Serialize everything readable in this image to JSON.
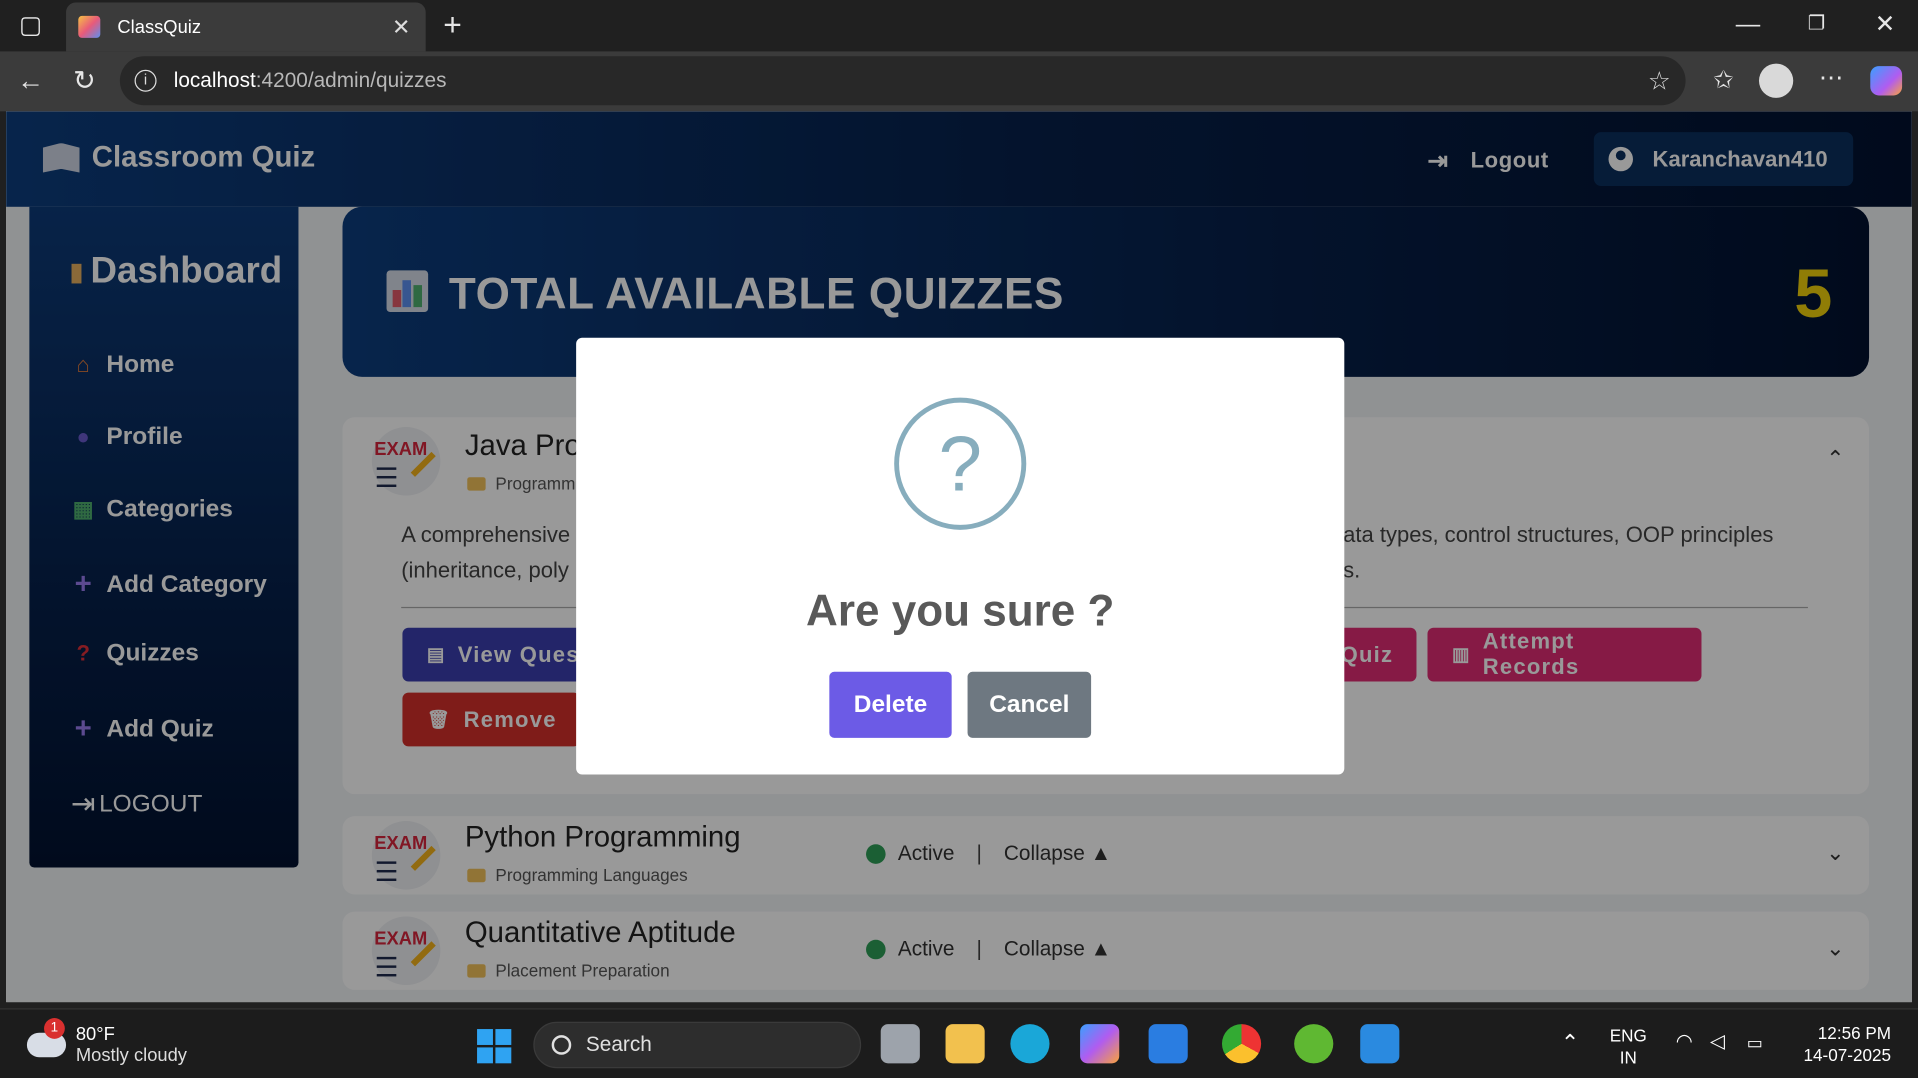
{
  "browser": {
    "tab_title": "ClassQuiz",
    "url_host": "localhost",
    "url_path": ":4200/admin/quizzes"
  },
  "app": {
    "brand": "Classroom Quiz",
    "logout_label": "Logout",
    "username": "Karanchavan410"
  },
  "sidebar": {
    "title": "Dashboard",
    "items": [
      {
        "label": "Home",
        "icon": "home-icon"
      },
      {
        "label": "Profile",
        "icon": "profile-icon"
      },
      {
        "label": "Categories",
        "icon": "categories-icon"
      },
      {
        "label": "Add Category",
        "icon": "plus-icon"
      },
      {
        "label": "Quizzes",
        "icon": "question-icon"
      },
      {
        "label": "Add Quiz",
        "icon": "plus-icon"
      },
      {
        "label": "LOGOUT",
        "icon": "logout-icon"
      }
    ]
  },
  "hero": {
    "title": "TOTAL AVAILABLE QUIZZES",
    "count": "5"
  },
  "quizzes": [
    {
      "title": "Java Pro",
      "category": "Programm",
      "description_line1": "A comprehensive",
      "description_line1_end": "data types, control structures, OOP principles",
      "description_line2": "(inheritance, poly",
      "description_line2_end": "es.",
      "buttons": {
        "view": "View Ques",
        "update_partial": "Quiz",
        "attempts": "Attempt Records",
        "remove": "Remove"
      }
    },
    {
      "title": "Python Programming",
      "category": "Programming Languages",
      "status": "Active",
      "sep": "|",
      "toggle": "Collapse ▲"
    },
    {
      "title": "Quantitative Aptitude",
      "category": "Placement Preparation",
      "status": "Active",
      "sep": "|",
      "toggle": "Collapse ▲"
    }
  ],
  "modal": {
    "icon": "?",
    "message": "Are you sure ?",
    "confirm": "Delete",
    "cancel": "Cancel"
  },
  "taskbar": {
    "weather_badge": "1",
    "temp": "80°F",
    "condition": "Mostly cloudy",
    "search_placeholder": "Search",
    "lang1": "ENG",
    "lang2": "IN",
    "time": "12:56 PM",
    "date": "14-07-2025"
  },
  "colors": {
    "primary": "#6c5be6",
    "cancel": "#6e7881",
    "view": "#3b3fb0",
    "pink": "#e02c74",
    "remove": "#d42f2a"
  }
}
